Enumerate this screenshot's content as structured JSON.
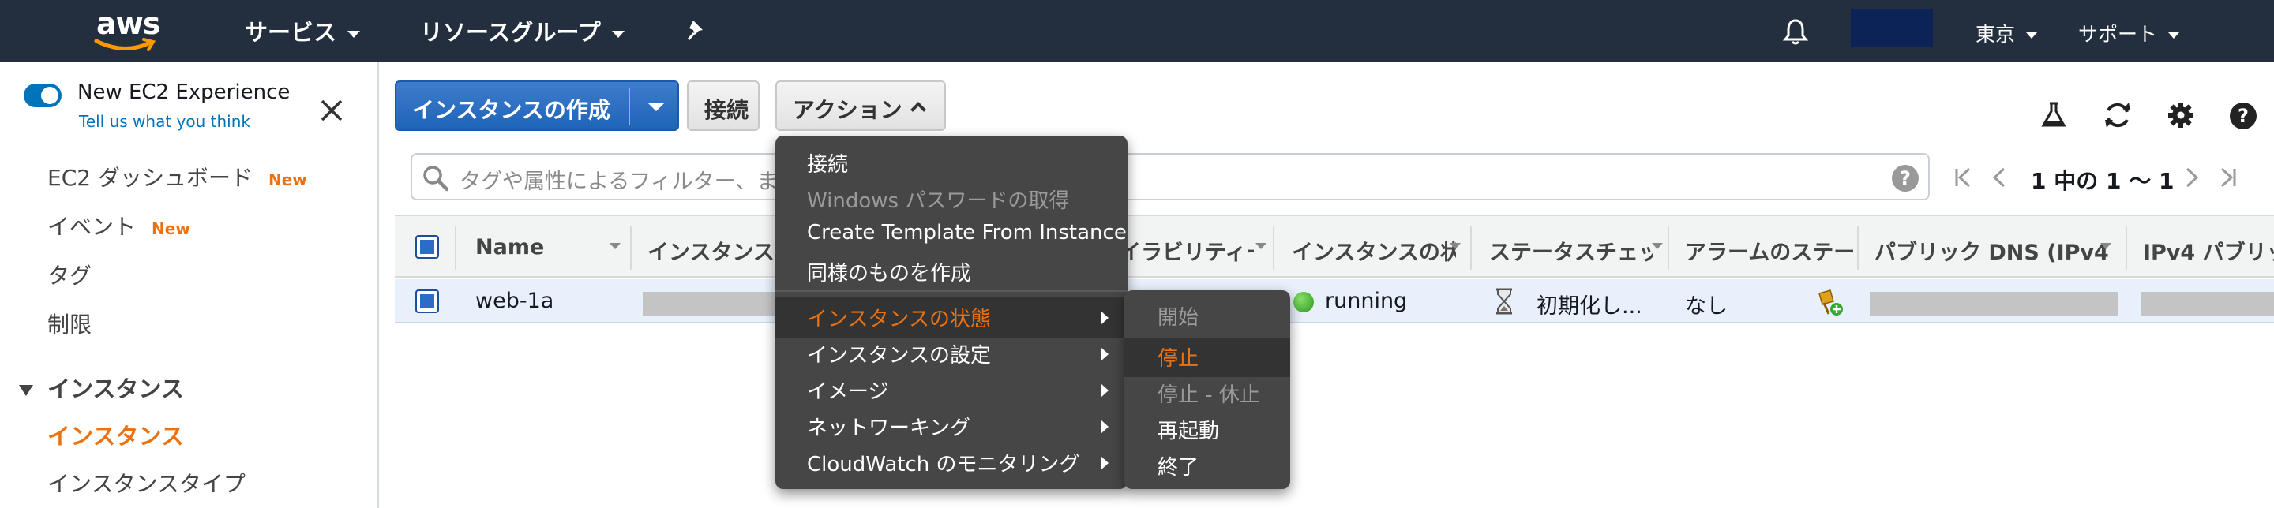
{
  "topnav": {
    "logo": "aws",
    "services": "サービス",
    "resource_groups": "リソースグループ",
    "region": "東京",
    "support": "サポート"
  },
  "sidebar": {
    "experience_title": "New EC2 Experience",
    "experience_link": "Tell us what you think",
    "new_badge": "New",
    "items": [
      {
        "label": "EC2 ダッシュボード",
        "badge": "New"
      },
      {
        "label": "イベント",
        "badge": "New"
      },
      {
        "label": "タグ"
      },
      {
        "label": "制限"
      }
    ],
    "section": "インスタンス",
    "active_item": "インスタンス",
    "next_item": "インスタンスタイプ"
  },
  "toolbar": {
    "create_instance": "インスタンスの作成",
    "connect": "接続",
    "actions": "アクション"
  },
  "filter": {
    "placeholder": "タグや属性によるフィルター、また",
    "help": "?"
  },
  "pager": {
    "text": "1 中の 1 〜 1"
  },
  "table": {
    "columns": [
      "Name",
      "インスタンス",
      "イラビリティー",
      "インスタンスの状",
      "ステータスチェッ",
      "アラームのステー",
      "パブリック DNS (IPv4)",
      "IPv4 パブリッ"
    ],
    "row": {
      "name": "web-1a",
      "state": "running",
      "status_check": "初期化し...",
      "alarm": "なし"
    }
  },
  "actions_menu": {
    "items": [
      {
        "label": "接続",
        "disabled": false
      },
      {
        "label": "Windows パスワードの取得",
        "disabled": true
      },
      {
        "label": "Create Template From Instance",
        "disabled": false
      },
      {
        "label": "同様のものを作成",
        "disabled": false
      },
      {
        "label": "インスタンスの状態",
        "highlighted": true,
        "submenu": true
      },
      {
        "label": "インスタンスの設定",
        "submenu": true
      },
      {
        "label": "イメージ",
        "submenu": true
      },
      {
        "label": "ネットワーキング",
        "submenu": true
      },
      {
        "label": "CloudWatch のモニタリング",
        "submenu": true
      }
    ]
  },
  "state_submenu": {
    "items": [
      {
        "label": "開始",
        "disabled": true
      },
      {
        "label": "停止",
        "highlighted": true
      },
      {
        "label": "停止 - 休止",
        "disabled": true
      },
      {
        "label": "再起動"
      },
      {
        "label": "終了"
      }
    ]
  },
  "colors": {
    "nav_bg": "#232f3e",
    "accent_orange": "#ec7211",
    "primary_blue": "#1e64b8",
    "menu_bg": "#464646"
  }
}
